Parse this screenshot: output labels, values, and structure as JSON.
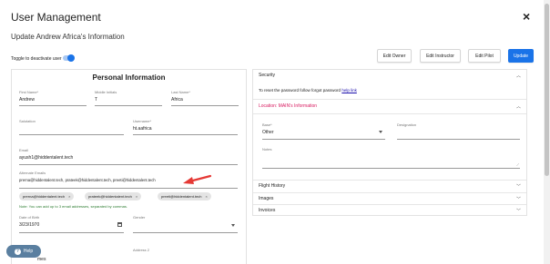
{
  "dialog": {
    "title": "User Management",
    "close_icon": "×",
    "subtitle": "Update Andrew Africa's Information",
    "toggle_label": "Toggle to deactivate user",
    "toggle_on": true
  },
  "toolbar": {
    "edit_owner": "Edit Owner",
    "edit_instructor": "Edit Instructor",
    "edit_pilot": "Edit Pilot",
    "update": "Update"
  },
  "personal": {
    "title": "Personal Information",
    "first_name_label": "First Name*",
    "first_name": "Andrew",
    "middle_label": "Middle Initials",
    "middle": "T",
    "last_name_label": "Last Name*",
    "last_name": "Africa",
    "salutation_label": "Salutation",
    "salutation": "",
    "username_label": "Username*",
    "username": "ht.aafrica",
    "email_label": "Email",
    "email": "ayush1@hiddentalent.tech",
    "alt_email_label": "Alternate Emails",
    "alt_email_value": "prerna@hiddentalent.tech, prateek@hiddentalent.tech, preeti@hiddentalent.tech",
    "chips": [
      "prerna@hiddentalent.tech",
      "prateek@hiddentalent.tech",
      "preeti@hiddentalent.tech"
    ],
    "note": "Note: You can add up to 3 email addresses, separated by commas.",
    "dob_label": "Date of Birth",
    "dob": "3/23/1970",
    "gender_label": "Gender",
    "gender": "",
    "address2_label": "Address 2",
    "address1_partial": "mes"
  },
  "right": {
    "security_title": "Security",
    "security_text": "To reset the password follow forgot password",
    "security_link": "help link",
    "location_title": "Location: MAIN's Information",
    "base_label": "Base*",
    "base_value": "Other",
    "designation_label": "Designation",
    "notes_label": "Notes",
    "flight_history": "Flight History",
    "images": "Images",
    "invoices": "Invoices"
  },
  "help": {
    "label": "Help",
    "icon": "?"
  },
  "colors": {
    "primary": "#1a73e8",
    "location_accent": "#d81b60",
    "note_green": "#2e7d32",
    "arrow_red": "#e53935"
  }
}
